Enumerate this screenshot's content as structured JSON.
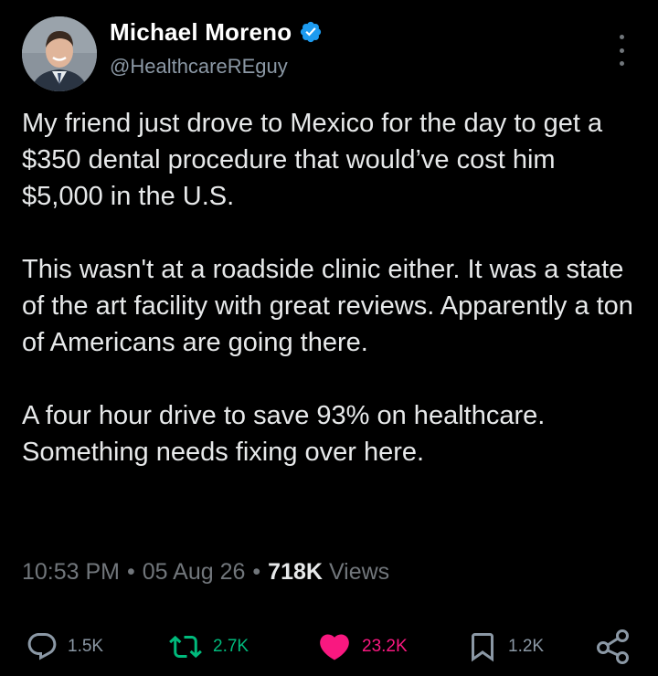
{
  "author": {
    "name": "Michael Moreno",
    "handle": "@HealthcareREguy",
    "verified": true,
    "avatar": "profile-photo"
  },
  "tweet": {
    "paragraphs": [
      "My friend just drove to Mexico for the day to get a $350 dental procedure that would’ve cost him $5,000 in the U.S.",
      "This wasn't at a roadside clinic either. It was a state of the art facility with great reviews. Apparently a ton of Americans are going there.",
      "A four hour drive to save 93% on healthcare. Something needs fixing over here."
    ],
    "time": "10:53 PM",
    "date": "05 Aug 26",
    "separator": "•",
    "views_count": "718K",
    "views_label": "Views"
  },
  "actions": {
    "replies": "1.5K",
    "reposts": "2.7K",
    "likes": "23.2K",
    "bookmarks": "1.2K"
  },
  "icons": {
    "verified": "verified-badge-icon",
    "more": "more-options-icon",
    "reply": "reply-icon",
    "repost": "repost-icon",
    "like": "heart-icon",
    "bookmark": "bookmark-icon",
    "share": "share-icon"
  },
  "colors": {
    "background": "#000000",
    "verified": "#1d9bf0",
    "repost": "#00ba7c",
    "like": "#f91880",
    "muted": "#71767b"
  }
}
